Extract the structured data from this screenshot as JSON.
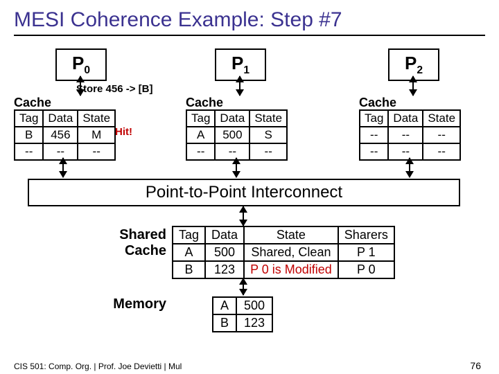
{
  "title": "MESI Coherence Example: Step #7",
  "processors": {
    "p0": {
      "label": "P",
      "sub": "0"
    },
    "p1": {
      "label": "P",
      "sub": "1"
    },
    "p2": {
      "label": "P",
      "sub": "2"
    }
  },
  "annotation": "Store 456 -> [B]",
  "hit": "Hit!",
  "cache_label": "Cache",
  "headers": {
    "tag": "Tag",
    "data": "Data",
    "state": "State",
    "sharers": "Sharers"
  },
  "c0": {
    "r0": {
      "tag": "B",
      "data": "456",
      "state": "M"
    },
    "r1": {
      "tag": "--",
      "data": "--",
      "state": "--"
    }
  },
  "c1": {
    "r0": {
      "tag": "A",
      "data": "500",
      "state": "S"
    },
    "r1": {
      "tag": "--",
      "data": "--",
      "state": "--"
    }
  },
  "c2": {
    "r0": {
      "tag": "--",
      "data": "--",
      "state": "--"
    },
    "r1": {
      "tag": "--",
      "data": "--",
      "state": "--"
    }
  },
  "interconnect": "Point-to-Point Interconnect",
  "shared_label": "Shared Cache",
  "memory_label": "Memory",
  "shared": {
    "r0": {
      "tag": "A",
      "data": "500",
      "state": "Shared, Clean",
      "sharers": "P 1"
    },
    "r1": {
      "tag": "B",
      "data": "123",
      "state": "P 0 is Modified",
      "sharers": "P 0"
    }
  },
  "mem": {
    "r0": {
      "tag": "A",
      "data": "500"
    },
    "r1": {
      "tag": "B",
      "data": "123"
    }
  },
  "footer": "CIS 501: Comp. Org. | Prof. Joe Devietti | Mul",
  "pagenum": "76"
}
